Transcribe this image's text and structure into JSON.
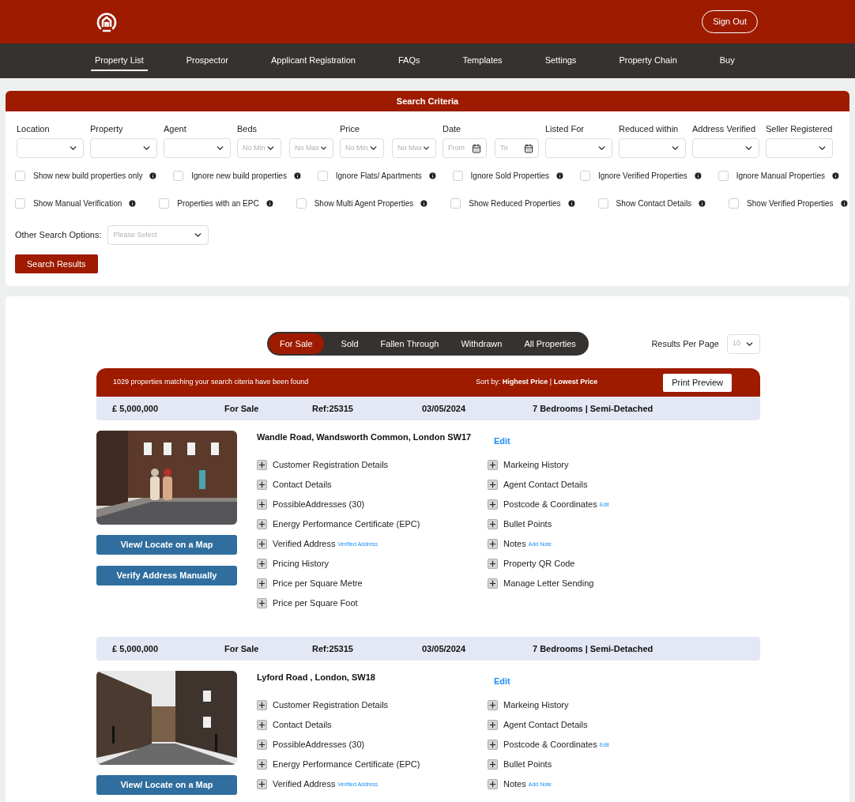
{
  "header": {
    "sign_out": "Sign Out"
  },
  "nav": [
    {
      "label": "Property List",
      "selected": true
    },
    {
      "label": "Prospector",
      "selected": false
    },
    {
      "label": "Applicant Registration",
      "selected": false
    },
    {
      "label": "FAQs",
      "selected": false
    },
    {
      "label": "Templates",
      "selected": false
    },
    {
      "label": "Settings",
      "selected": false
    },
    {
      "label": "Property Chain",
      "selected": false
    },
    {
      "label": "Buy",
      "selected": false
    }
  ],
  "search": {
    "title": "Search Criteria",
    "filters": [
      {
        "label": "Location",
        "kind": "select"
      },
      {
        "label": "Property",
        "kind": "select"
      },
      {
        "label": "Agent",
        "kind": "select"
      },
      {
        "label": "Beds",
        "kind": "range",
        "inputs": [
          {
            "placeholder": "No Min"
          },
          {
            "placeholder": "No Max"
          }
        ]
      },
      {
        "label": "Price",
        "kind": "range",
        "inputs": [
          {
            "placeholder": "No Min"
          },
          {
            "placeholder": "No Max"
          }
        ]
      },
      {
        "label": "Date",
        "kind": "dates",
        "inputs": [
          {
            "placeholder": "From"
          },
          {
            "placeholder": "To"
          }
        ]
      },
      {
        "label": "Listed For",
        "kind": "select"
      },
      {
        "label": "Reduced within",
        "kind": "select"
      },
      {
        "label": "Address Verified",
        "kind": "select"
      },
      {
        "label": "Seller Registered",
        "kind": "select"
      }
    ],
    "checkbox_rows": [
      [
        {
          "label": "Show new build properties only",
          "checked": false
        },
        {
          "label": "Ignore new build properties",
          "checked": false
        },
        {
          "label": "Ignore Flats/ Apartments",
          "checked": false
        },
        {
          "label": "Ignore Sold Properties",
          "checked": false
        },
        {
          "label": "Ignore Verified Properties",
          "checked": false
        },
        {
          "label": "Ignore Manual Properties",
          "checked": false
        }
      ],
      [
        {
          "label": "Show Manual Verification",
          "checked": false
        },
        {
          "label": "Properties with an EPC",
          "checked": false
        },
        {
          "label": "Show Multi Agent Properties",
          "checked": false
        },
        {
          "label": "Show Reduced Properties",
          "checked": false
        },
        {
          "label": "Show Contact Details",
          "checked": false
        },
        {
          "label": "Show Verified Properties",
          "checked": false
        }
      ]
    ],
    "other_options": {
      "label": "Other Search Options:",
      "placeholder": "Please Select"
    },
    "submit": "Search Results"
  },
  "results": {
    "tabs": [
      {
        "label": "For Sale",
        "selected": true
      },
      {
        "label": "Sold",
        "selected": false
      },
      {
        "label": "Fallen Through",
        "selected": false
      },
      {
        "label": "Withdrawn",
        "selected": false
      },
      {
        "label": "All Properties",
        "selected": false
      }
    ],
    "per_page_label": "Results Per Page",
    "per_page": "10",
    "count_text": "1029 properties matching your search citeria have been found",
    "sort_text": "Sort by: **Highest Price** | **Lowest Price**",
    "print": "Print Preview",
    "properties": [
      {
        "price": "£ 5,000,000",
        "status": "For Sale",
        "ref": "Ref:25315",
        "date": "03/05/2024",
        "summary": "7 Bedrooms | Semi-Detached",
        "address": "Wandle Road, Wandsworth Common, London SW17",
        "edit": "Edit",
        "picture": {
          "kind": "picture"
        },
        "buttons": [
          "View/ Locate on a Map",
          "Verify Address Manually"
        ],
        "left_items": [
          {
            "label": "Customer Registration Details"
          },
          {
            "label": "Contact Details"
          },
          {
            "label": "PossibleAddresses (30)"
          },
          {
            "label": "Energy Performance Certificate (EPC)"
          },
          {
            "label": "Verified Address",
            "link": "Verified Address"
          },
          {
            "label": "Pricing History"
          },
          {
            "label": "Price per Square Metre"
          },
          {
            "label": "Price per Square Foot"
          }
        ],
        "right_items": [
          {
            "label": "Markeing History"
          },
          {
            "label": "Agent Contact Details"
          },
          {
            "label": "Postcode & Coordinates",
            "link": "Edit"
          },
          {
            "label": "Bullet Points"
          },
          {
            "label": "Notes",
            "link": "Add Note"
          },
          {
            "label": "Property QR Code"
          },
          {
            "label": "Manage Letter Sending"
          }
        ]
      },
      {
        "price": "£ 5,000,000",
        "status": "For Sale",
        "ref": "Ref:25315",
        "date": "03/05/2024",
        "summary": "7 Bedrooms | Semi-Detached",
        "address": "Lyford Road , London, SW18",
        "edit": "Edit",
        "picture": {
          "kind": "picture"
        },
        "buttons": [
          "View/ Locate on a Map"
        ],
        "left_items": [
          {
            "label": "Customer Registration Details"
          },
          {
            "label": "Contact Details"
          },
          {
            "label": "PossibleAddresses (30)"
          },
          {
            "label": "Energy Performance Certificate (EPC)"
          },
          {
            "label": "Verified Address",
            "link": "Verified Address"
          }
        ],
        "right_items": [
          {
            "label": "Markeing History"
          },
          {
            "label": "Agent Contact Details"
          },
          {
            "label": "Postcode & Coordinates",
            "link": "Edit"
          },
          {
            "label": "Bullet Points"
          },
          {
            "label": "Notes",
            "link": "Add Note"
          }
        ]
      }
    ]
  }
}
